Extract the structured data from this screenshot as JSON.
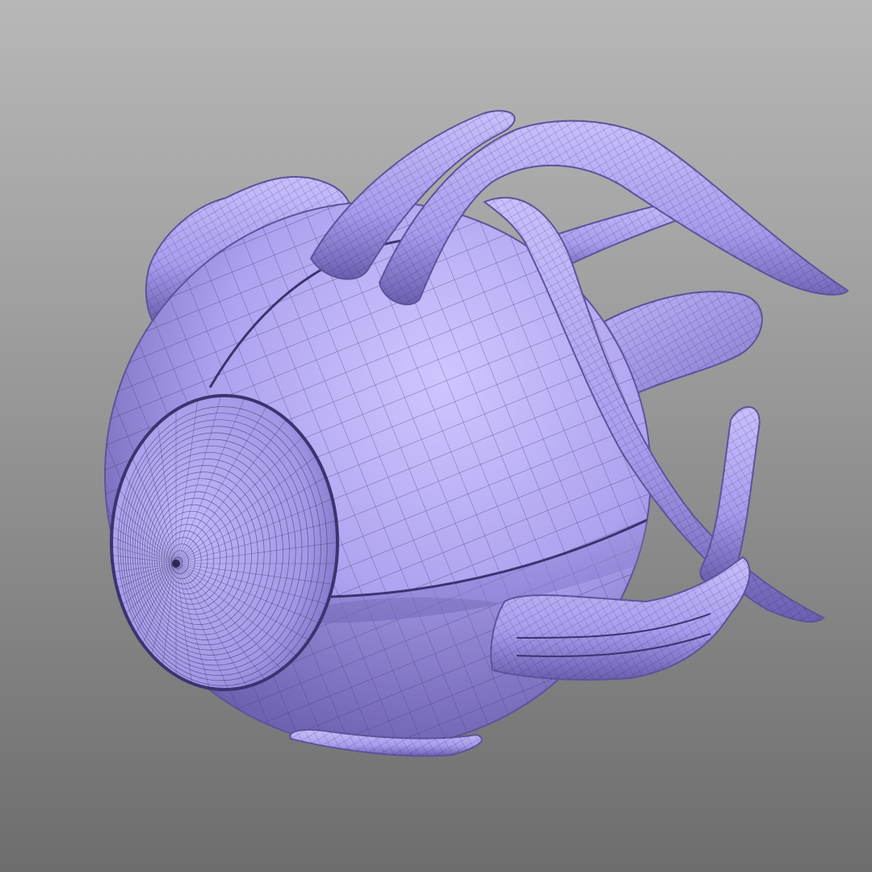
{
  "viewport": {
    "background_top": "#b7b7b7",
    "background_bottom": "#6d6d6d",
    "mesh_fill": "#b1a7f2",
    "mesh_light": "#cbc2ff",
    "mesh_shadow": "#5f549c",
    "wire_color": "#2e2852",
    "display_mode": "wireframe-on-shaded"
  },
  "model": {
    "subject": "eyeball-with-optic-nerve-and-extraocular-muscles",
    "parts": [
      "eyeball",
      "cornea",
      "optic-nerve",
      "superior-rectus",
      "superior-oblique",
      "lateral-rectus",
      "inferior-rectus",
      "medial-rectus",
      "fat-pad"
    ]
  }
}
